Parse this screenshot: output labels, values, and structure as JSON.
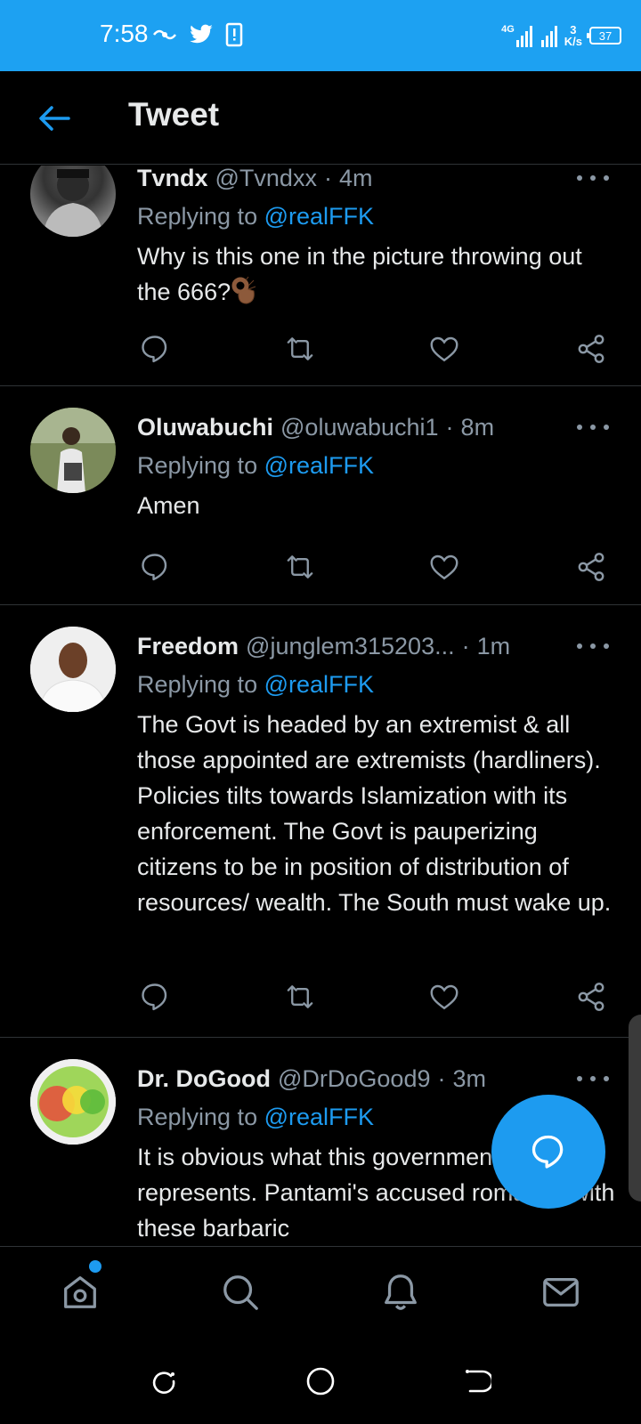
{
  "status_bar": {
    "time": "7:58",
    "network_type": "4G",
    "net_speed_value": "3",
    "net_speed_unit": "K/s",
    "battery": "37",
    "icons": [
      "vpn-icon",
      "twitter-icon",
      "phone-alert-icon",
      "signal-icon"
    ]
  },
  "header": {
    "title": "Tweet",
    "back_icon": "arrow-left-icon"
  },
  "tweets": [
    {
      "name": "Tvndx",
      "handle": "@Tvndxx",
      "time": "4m",
      "replying_prefix": "Replying to",
      "replying_to": "@realFFK",
      "text": "Why is this one in the picture throwing out the 666?",
      "emoji": "ok-hand-icon"
    },
    {
      "name": "Oluwabuchi",
      "handle": "@oluwabuchi1",
      "time": "8m",
      "replying_prefix": "Replying to",
      "replying_to": "@realFFK",
      "text": "Amen"
    },
    {
      "name": "Freedom",
      "handle": "@junglem315203...",
      "time": "1m",
      "replying_prefix": "Replying to",
      "replying_to": "@realFFK",
      "text": "The Govt is headed by an extremist & all those appointed are extremists (hardliners). Policies tilts towards Islamization with its enforcement. The Govt is pauperizing citizens to be in position of distribution of resources/ wealth. The South must wake up."
    },
    {
      "name": "Dr. DoGood",
      "handle": "@DrDoGood9",
      "time": "3m",
      "replying_prefix": "Replying to",
      "replying_to": "@realFFK",
      "text": "It is obvious what this government represents. Pantami's accused romance with these barbaric"
    }
  ],
  "separator": "·",
  "actions": [
    "reply-icon",
    "retweet-icon",
    "like-icon",
    "share-icon"
  ],
  "bottom_nav": [
    "home-icon",
    "search-icon",
    "notifications-icon",
    "messages-icon"
  ],
  "system_nav": [
    "recents-icon",
    "home-circle-icon",
    "back-icon"
  ],
  "colors": {
    "status_bar": "#1da1f2",
    "accent": "#1d9bf0",
    "text": "#e7e9ea",
    "secondary": "#8b98a5",
    "divider": "#2f3336",
    "background": "#000000"
  }
}
